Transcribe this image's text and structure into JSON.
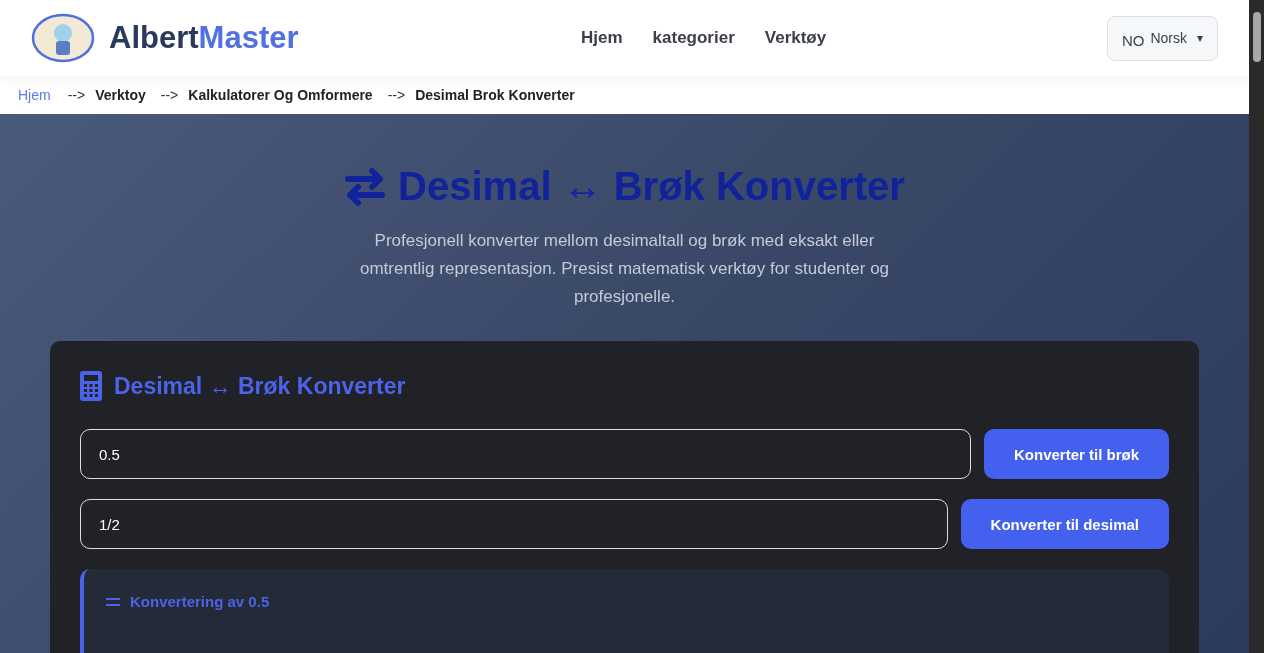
{
  "header": {
    "logo": {
      "part_1": "Albert",
      "part_2": "Master"
    },
    "nav": [
      {
        "label": "Hjem"
      },
      {
        "label": "kategorier"
      },
      {
        "label": "Verktøy"
      }
    ],
    "language": {
      "code": "NO",
      "label": "Norsk",
      "caret": "▾"
    }
  },
  "breadcrumb": [
    {
      "label": "Hjem",
      "kind": "link"
    },
    {
      "label": "Verktoy",
      "kind": "crumb",
      "separator": "-->"
    },
    {
      "label": "Kalkulatorer Og Omformere",
      "kind": "crumb",
      "separator": "-->"
    },
    {
      "label": "Desimal Brok Konverter",
      "kind": "crumb",
      "separator": "-->"
    }
  ],
  "hero": {
    "title": "Desimal ↔ Brøk Konverter",
    "description": "Profesjonell konverter mellom desimaltall og brøk med eksakt eller omtrentlig representasjon. Presist matematisk verktøy for studenter og profesjonelle."
  },
  "card": {
    "title": "Desimal ↔ Brøk Konverter",
    "rows": [
      {
        "value": "0.5",
        "button": "Konverter til brøk"
      },
      {
        "value": "1/2",
        "button": "Konverter til desimal"
      }
    ],
    "result": {
      "title": "Konvertering av 0.5"
    }
  }
}
